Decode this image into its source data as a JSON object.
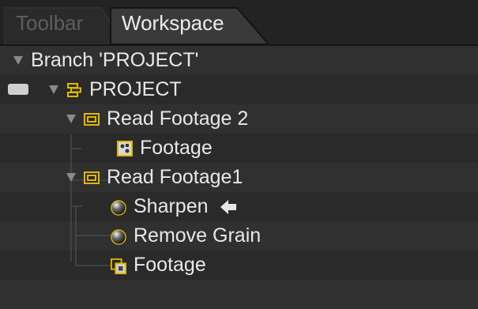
{
  "tabs": [
    {
      "label": "Toolbar",
      "active": false
    },
    {
      "label": "Workspace",
      "active": true
    }
  ],
  "tree": {
    "branch_label": "Branch 'PROJECT'",
    "project_label": "PROJECT",
    "read_footage_2": {
      "label": "Read Footage 2",
      "children": [
        "Footage"
      ]
    },
    "read_footage_1": {
      "label": "Read Footage1",
      "children": [
        "Sharpen",
        "Remove Grain",
        "Footage"
      ]
    }
  },
  "icons": {
    "project": "project-node-icon",
    "read": "read-footage-icon",
    "footage_still": "footage-still-icon",
    "effect": "effect-sphere-icon",
    "footage_sequence": "footage-sequence-icon",
    "pointer": "pointer-arrow-icon"
  },
  "colors": {
    "accent": "#e0b800",
    "text": "#e8e8e8",
    "background": "#2b2b2b"
  }
}
